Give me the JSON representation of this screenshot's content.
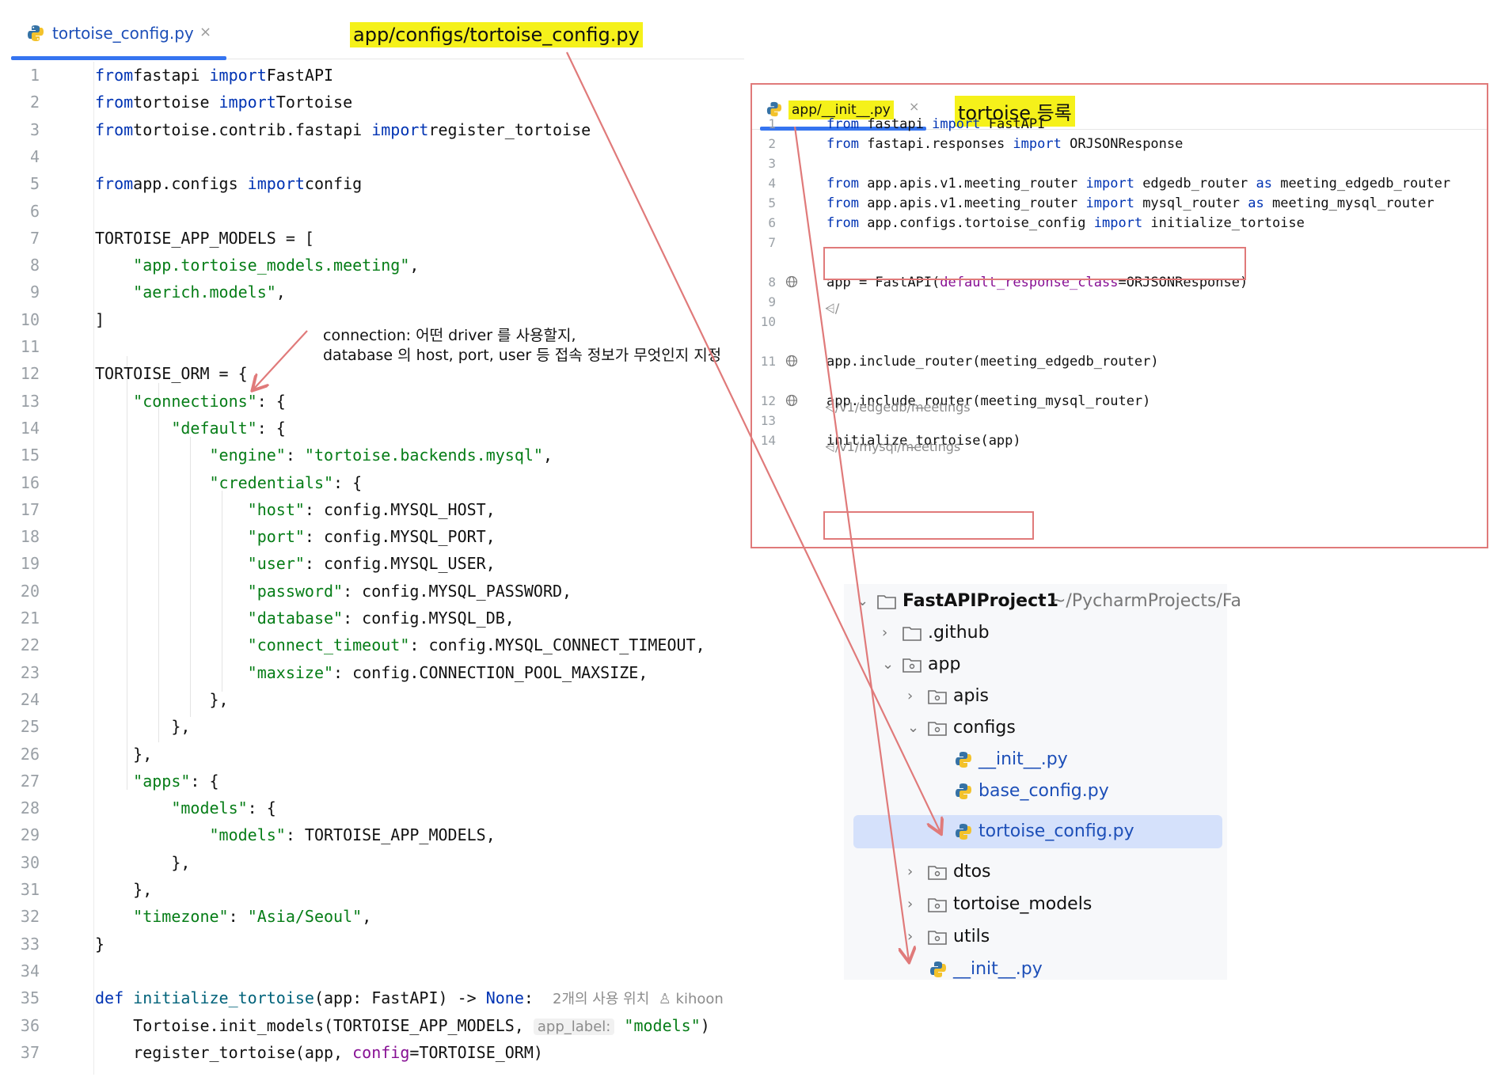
{
  "main_editor": {
    "tab_label": "tortoise_config.py",
    "tab_close": "×",
    "path_annotation": "app/configs/tortoise_config.py",
    "annotation_line1": "connection: 어떤 driver 를 사용할지,",
    "annotation_line2": "database 의 host, port, user 등 접속 정보가 무엇인지 지정",
    "lines": [
      [
        [
          "kw",
          "from"
        ],
        [
          "",
          "fastapi "
        ],
        [
          "kw",
          "import"
        ],
        [
          "",
          "FastAPI"
        ]
      ],
      [
        [
          "kw",
          "from"
        ],
        [
          "",
          "tortoise "
        ],
        [
          "kw",
          "import"
        ],
        [
          "",
          "Tortoise"
        ]
      ],
      [
        [
          "kw",
          "from"
        ],
        [
          "",
          "tortoise.contrib.fastapi "
        ],
        [
          "kw",
          "import"
        ],
        [
          "",
          "register_tortoise"
        ]
      ],
      [],
      [
        [
          "kw",
          "from"
        ],
        [
          "",
          "app.configs "
        ],
        [
          "kw",
          "import"
        ],
        [
          "",
          "config"
        ]
      ],
      [],
      [
        [
          "",
          "TORTOISE_APP_MODELS = ["
        ]
      ],
      [
        [
          "",
          "    "
        ],
        [
          "str",
          "\"app.tortoise_models.meeting\""
        ],
        [
          "",
          ","
        ]
      ],
      [
        [
          "",
          "    "
        ],
        [
          "str",
          "\"aerich.models\""
        ],
        [
          "",
          ","
        ]
      ],
      [
        [
          "",
          "]"
        ]
      ],
      [],
      [
        [
          "",
          "TORTOISE_ORM = {"
        ]
      ],
      [
        [
          "",
          "    "
        ],
        [
          "str",
          "\"connections\""
        ],
        [
          "",
          ": {"
        ]
      ],
      [
        [
          "",
          "        "
        ],
        [
          "str",
          "\"default\""
        ],
        [
          "",
          ": {"
        ]
      ],
      [
        [
          "",
          "            "
        ],
        [
          "str",
          "\"engine\""
        ],
        [
          "",
          ": "
        ],
        [
          "str",
          "\"tortoise.backends.mysql\""
        ],
        [
          "",
          ","
        ]
      ],
      [
        [
          "",
          "            "
        ],
        [
          "str",
          "\"credentials\""
        ],
        [
          "",
          ": {"
        ]
      ],
      [
        [
          "",
          "                "
        ],
        [
          "str",
          "\"host\""
        ],
        [
          "",
          ": config.MYSQL_HOST,"
        ]
      ],
      [
        [
          "",
          "                "
        ],
        [
          "str",
          "\"port\""
        ],
        [
          "",
          ": config.MYSQL_PORT,"
        ]
      ],
      [
        [
          "",
          "                "
        ],
        [
          "str",
          "\"user\""
        ],
        [
          "",
          ": config.MYSQL_USER,"
        ]
      ],
      [
        [
          "",
          "                "
        ],
        [
          "str",
          "\"password\""
        ],
        [
          "",
          ": config.MYSQL_PASSWORD,"
        ]
      ],
      [
        [
          "",
          "                "
        ],
        [
          "str",
          "\"database\""
        ],
        [
          "",
          ": config.MYSQL_DB,"
        ]
      ],
      [
        [
          "",
          "                "
        ],
        [
          "str",
          "\"connect_timeout\""
        ],
        [
          "",
          ": config.MYSQL_CONNECT_TIMEOUT,"
        ]
      ],
      [
        [
          "",
          "                "
        ],
        [
          "str",
          "\"maxsize\""
        ],
        [
          "",
          ": config.CONNECTION_POOL_MAXSIZE,"
        ]
      ],
      [
        [
          "",
          "            },"
        ]
      ],
      [
        [
          "",
          "        },"
        ]
      ],
      [
        [
          "",
          "    },"
        ]
      ],
      [
        [
          "",
          "    "
        ],
        [
          "str",
          "\"apps\""
        ],
        [
          "",
          ": {"
        ]
      ],
      [
        [
          "",
          "        "
        ],
        [
          "str",
          "\"models\""
        ],
        [
          "",
          ": {"
        ]
      ],
      [
        [
          "",
          "            "
        ],
        [
          "str",
          "\"models\""
        ],
        [
          "",
          ": TORTOISE_APP_MODELS,"
        ]
      ],
      [
        [
          "",
          "        },"
        ]
      ],
      [
        [
          "",
          "    },"
        ]
      ],
      [
        [
          "",
          "    "
        ],
        [
          "str",
          "\"timezone\""
        ],
        [
          "",
          ": "
        ],
        [
          "str",
          "\"Asia/Seoul\""
        ],
        [
          "",
          ","
        ]
      ],
      [
        [
          "",
          "}"
        ]
      ],
      [],
      [
        [
          "kw",
          "def "
        ],
        [
          "fn",
          "initialize_tortoise"
        ],
        [
          "",
          "(app: FastAPI) -> "
        ],
        [
          "kw",
          "None"
        ],
        [
          "",
          ":  "
        ],
        [
          "meta",
          "2개의 사용 위치  ♙ kihoon"
        ]
      ],
      [
        [
          "",
          "    Tortoise.init_models(TORTOISE_APP_MODELS, "
        ],
        [
          "hint",
          "app_label:"
        ],
        [
          "",
          ""
        ],
        [
          "str",
          " \"models\""
        ],
        [
          "",
          ")"
        ]
      ],
      [
        [
          "",
          "    register_tortoise(app, "
        ],
        [
          "pm",
          "config"
        ],
        [
          "",
          "=TORTOISE_ORM)"
        ]
      ]
    ]
  },
  "init_panel": {
    "tab_label": "app/__init__.py",
    "tab_close": "×",
    "title": "tortoise 등록",
    "route_root": "/",
    "route_edgedb": "/v1/edgedb/meetings",
    "route_mysql": "/v1/mysql/meetings",
    "lines": [
      {
        "n": "1",
        "t": [
          [
            "kw",
            "from"
          ],
          [
            "",
            " fastapi "
          ],
          [
            "kw",
            "import"
          ],
          [
            "",
            " FastAPI"
          ]
        ]
      },
      {
        "n": "2",
        "t": [
          [
            "kw",
            "from"
          ],
          [
            "",
            " fastapi.responses "
          ],
          [
            "kw",
            "import"
          ],
          [
            "",
            " ORJSONResponse"
          ]
        ]
      },
      {
        "n": "3",
        "t": []
      },
      {
        "n": "4",
        "t": [
          [
            "kw",
            "from"
          ],
          [
            "",
            " app.apis.v1.meeting_router "
          ],
          [
            "kw",
            "import"
          ],
          [
            "",
            " edgedb_router "
          ],
          [
            "kw",
            "as"
          ],
          [
            "",
            " meeting_edgedb_router"
          ]
        ]
      },
      {
        "n": "5",
        "t": [
          [
            "kw",
            "from"
          ],
          [
            "",
            " app.apis.v1.meeting_router "
          ],
          [
            "kw",
            "import"
          ],
          [
            "",
            " mysql_router "
          ],
          [
            "kw",
            "as"
          ],
          [
            "",
            " meeting_mysql_router"
          ]
        ]
      },
      {
        "n": "6",
        "t": [
          [
            "kw",
            "from"
          ],
          [
            "",
            " app.configs.tortoise_config "
          ],
          [
            "kw",
            "import"
          ],
          [
            "",
            " initialize_tortoise"
          ]
        ]
      },
      {
        "n": "7",
        "t": []
      },
      {
        "n": "8",
        "t": [
          [
            "",
            "app = FastAPI("
          ],
          [
            "pm",
            "default_response_class"
          ],
          [
            "",
            "=ORJSONResponse)"
          ]
        ]
      },
      {
        "n": "9",
        "t": []
      },
      {
        "n": "10",
        "t": []
      },
      {
        "n": "11",
        "t": [
          [
            "",
            "app.include_router(meeting_edgedb_router)"
          ]
        ]
      },
      {
        "n": "12",
        "t": [
          [
            "",
            "app.include_router(meeting_mysql_router)"
          ]
        ]
      },
      {
        "n": "13",
        "t": []
      },
      {
        "n": "14",
        "t": [
          [
            "",
            "initialize_tortoise(app)"
          ]
        ]
      }
    ]
  },
  "project_tree": {
    "root_name": "FastAPIProject1",
    "root_path": "~/PycharmProjects/Fa",
    "items": {
      "github": ".github",
      "app": "app",
      "apis": "apis",
      "configs": "configs",
      "configs_init": "__init__.py",
      "base_config": "base_config.py",
      "tortoise_config": "tortoise_config.py",
      "dtos": "dtos",
      "tortoise_models": "tortoise_models",
      "utils": "utils",
      "app_init": "__init__.py"
    }
  },
  "colors": {
    "keyword": "#0033b3",
    "string": "#067d17",
    "highlight": "#f5f11a",
    "annotation_red": "#e07a7a",
    "selection": "#d5e1fb",
    "accent": "#3574f0"
  }
}
